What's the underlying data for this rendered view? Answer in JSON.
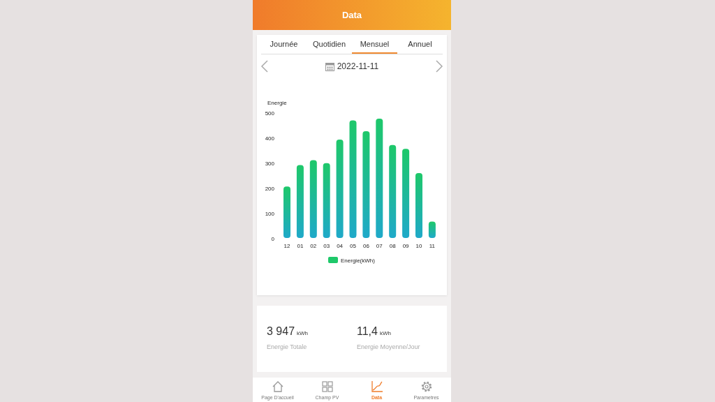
{
  "header": {
    "title": "Data"
  },
  "tabs": [
    {
      "label": "Journée",
      "selected": false
    },
    {
      "label": "Quotidien",
      "selected": false
    },
    {
      "label": "Mensuel",
      "selected": true
    },
    {
      "label": "Annuel",
      "selected": false
    }
  ],
  "date": "2022-11-11",
  "chart_data": {
    "type": "bar",
    "ylabel": "Energie",
    "categories": [
      "12",
      "01",
      "02",
      "03",
      "04",
      "05",
      "06",
      "07",
      "08",
      "09",
      "10",
      "11"
    ],
    "series": [
      {
        "name": "Energie(kWh)",
        "color": "#1ec86a",
        "values": [
          205,
          290,
          310,
          298,
          392,
          468,
          425,
          475,
          370,
          355,
          258,
          65
        ]
      }
    ],
    "ylim": [
      0,
      500
    ],
    "yticks": [
      0,
      100,
      200,
      300,
      400,
      500
    ]
  },
  "stats": [
    {
      "value": "3 947",
      "unit": "kWh",
      "label": "Energie Totale"
    },
    {
      "value": "11,4",
      "unit": "kWh",
      "label": "Energie Moyenne/Jour"
    }
  ],
  "nav": [
    {
      "kind": "home",
      "label": "Page D'accueil",
      "selected": false
    },
    {
      "kind": "grid",
      "label": "Champ PV",
      "selected": false
    },
    {
      "kind": "chart",
      "label": "Data",
      "selected": true
    },
    {
      "kind": "gear",
      "label": "Parametres",
      "selected": false
    }
  ]
}
